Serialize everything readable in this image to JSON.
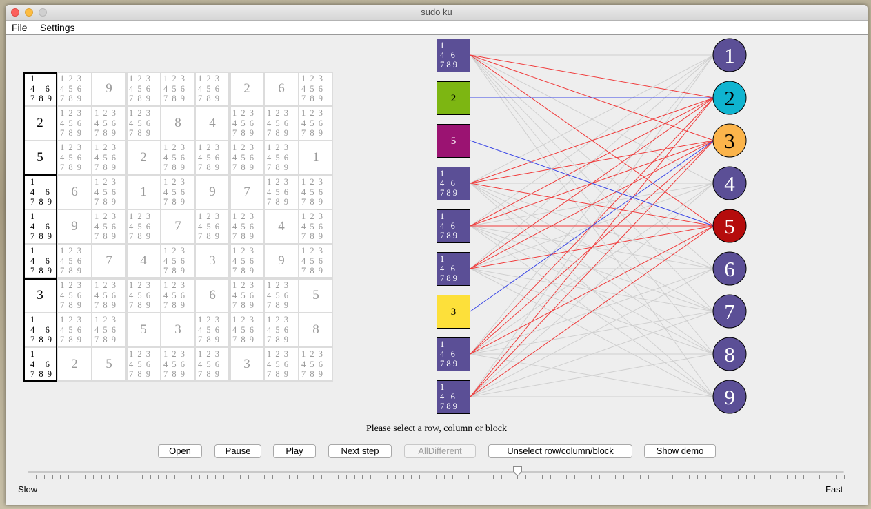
{
  "window": {
    "title": "sudo ku"
  },
  "menu": {
    "file": "File",
    "settings": "Settings"
  },
  "grid": {
    "rows": [
      [
        "?",
        "?",
        "9",
        "?",
        "?",
        "?",
        "2",
        "6",
        "?"
      ],
      [
        "2",
        "?",
        "?",
        "?",
        "8",
        "4",
        "?",
        "?",
        "?"
      ],
      [
        "5",
        "?",
        "?",
        "2",
        "?",
        "?",
        "?",
        "?",
        "1"
      ],
      [
        "?",
        "6",
        "?",
        "1",
        "?",
        "9",
        "7",
        "?",
        "?"
      ],
      [
        "?",
        "9",
        "?",
        "?",
        "7",
        "?",
        "?",
        "4",
        "?"
      ],
      [
        "?",
        "?",
        "7",
        "4",
        "?",
        "3",
        "?",
        "9",
        "?"
      ],
      [
        "3",
        "?",
        "?",
        "?",
        "?",
        "6",
        "?",
        "?",
        "5"
      ],
      [
        "?",
        "?",
        "?",
        "5",
        "3",
        "?",
        "?",
        "?",
        "8"
      ],
      [
        "?",
        "2",
        "5",
        "?",
        "?",
        "?",
        "3",
        "?",
        "?"
      ]
    ],
    "candidates_all": "1 2 3\n4 5 6\n7 8 9",
    "candidates_selected": "1\n4   6\n7 8 9",
    "selected_column": 0
  },
  "graph": {
    "left_nodes": [
      {
        "label": "1\n4   6\n7 8 9",
        "color": "#5b4f96",
        "text_color": "#ffffff"
      },
      {
        "label": "2",
        "color": "#7db612",
        "text_color": "#000000"
      },
      {
        "label": "5",
        "color": "#9b1372",
        "text_color": "#ffffff"
      },
      {
        "label": "1\n4   6\n7 8 9",
        "color": "#5b4f96",
        "text_color": "#ffffff"
      },
      {
        "label": "1\n4   6\n7 8 9",
        "color": "#5b4f96",
        "text_color": "#ffffff"
      },
      {
        "label": "1\n4   6\n7 8 9",
        "color": "#5b4f96",
        "text_color": "#ffffff"
      },
      {
        "label": "3",
        "color": "#fde03a",
        "text_color": "#000000"
      },
      {
        "label": "1\n4   6\n7 8 9",
        "color": "#5b4f96",
        "text_color": "#ffffff"
      },
      {
        "label": "1\n4   6\n7 8 9",
        "color": "#5b4f96",
        "text_color": "#ffffff"
      }
    ],
    "right_nodes": [
      {
        "label": "1",
        "color": "#5b4f96",
        "text_color": "#ffffff"
      },
      {
        "label": "2",
        "color": "#0fb4d0",
        "text_color": "#000000"
      },
      {
        "label": "3",
        "color": "#fbb44b",
        "text_color": "#000000"
      },
      {
        "label": "4",
        "color": "#5b4f96",
        "text_color": "#ffffff"
      },
      {
        "label": "5",
        "color": "#b50c0c",
        "text_color": "#ffffff"
      },
      {
        "label": "6",
        "color": "#5b4f96",
        "text_color": "#ffffff"
      },
      {
        "label": "7",
        "color": "#5b4f96",
        "text_color": "#ffffff"
      },
      {
        "label": "8",
        "color": "#5b4f96",
        "text_color": "#ffffff"
      },
      {
        "label": "9",
        "color": "#5b4f96",
        "text_color": "#ffffff"
      }
    ],
    "blue_edges": [
      [
        1,
        1
      ],
      [
        2,
        4
      ],
      [
        6,
        2
      ]
    ],
    "red_targets": [
      1,
      2,
      4
    ],
    "edge_colors": {
      "gray": "#cfcfcf",
      "red": "#f03a3a",
      "blue": "#3b47e6"
    }
  },
  "status": "Please select a row, column or block",
  "buttons": {
    "open": "Open",
    "pause": "Pause",
    "play": "Play",
    "next_step": "Next step",
    "all_different": "AllDifferent",
    "unselect": "Unselect row/column/block",
    "show_demo": "Show demo"
  },
  "slider": {
    "min_label": "Slow",
    "max_label": "Fast",
    "value": 0.6
  }
}
